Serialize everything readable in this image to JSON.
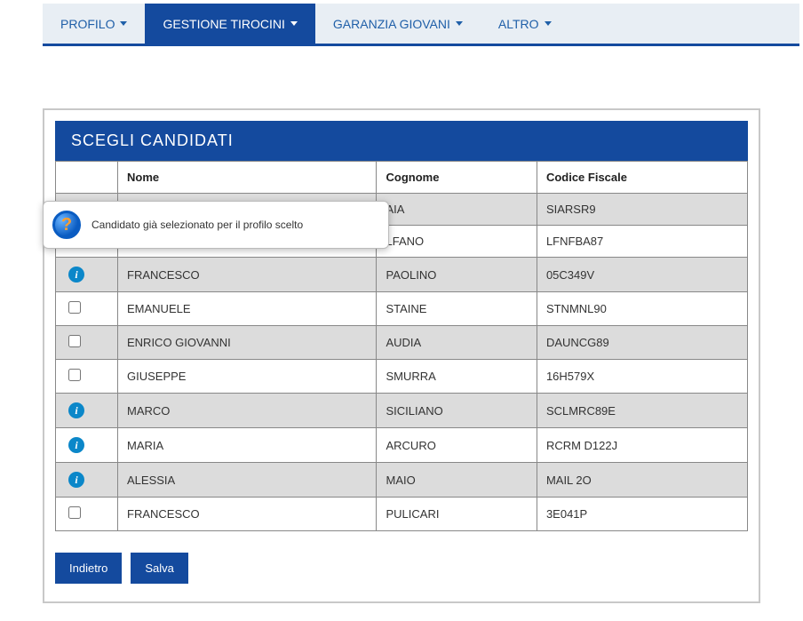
{
  "nav": {
    "items": [
      {
        "label": "PROFILO",
        "active": false
      },
      {
        "label": "GESTIONE TIROCINI",
        "active": true
      },
      {
        "label": "GARANZIA GIOVANI",
        "active": false
      },
      {
        "label": "ALTRO",
        "active": false
      }
    ]
  },
  "panel": {
    "title": "SCEGLI CANDIDATI"
  },
  "columns": {
    "nome": "Nome",
    "cognome": "Cognome",
    "cf": "Codice Fiscale"
  },
  "rows": [
    {
      "state": "hidden",
      "nome": "",
      "cognome": "AIA",
      "cf": "SIARSR9"
    },
    {
      "state": "hidden",
      "nome": "",
      "cognome": "LFANO",
      "cf": "LFNFBA87"
    },
    {
      "state": "info",
      "nome": "FRANCESCO",
      "cognome": "PAOLINO",
      "cf": "05C349V"
    },
    {
      "state": "check",
      "nome": "EMANUELE",
      "cognome": "STAINE",
      "cf": "STNMNL90"
    },
    {
      "state": "check",
      "nome": "ENRICO GIOVANNI",
      "cognome": "AUDIA",
      "cf": "DAUNCG89"
    },
    {
      "state": "check",
      "nome": "GIUSEPPE",
      "cognome": "SMURRA",
      "cf": "16H579X"
    },
    {
      "state": "info",
      "nome": "MARCO",
      "cognome": "SICILIANO",
      "cf": "SCLMRC89E"
    },
    {
      "state": "info",
      "nome": "MARIA",
      "cognome": "ARCURO",
      "cf": "RCRM         D122J"
    },
    {
      "state": "info",
      "nome": "ALESSIA",
      "cognome": "MAIO",
      "cf": "MAIL            2O"
    },
    {
      "state": "check",
      "nome": "FRANCESCO",
      "cognome": "PULICARI",
      "cf": "3E041P"
    }
  ],
  "buttons": {
    "back": "Indietro",
    "save": "Salva"
  },
  "tooltip": {
    "text": "Candidato già selezionato per il profilo scelto"
  }
}
